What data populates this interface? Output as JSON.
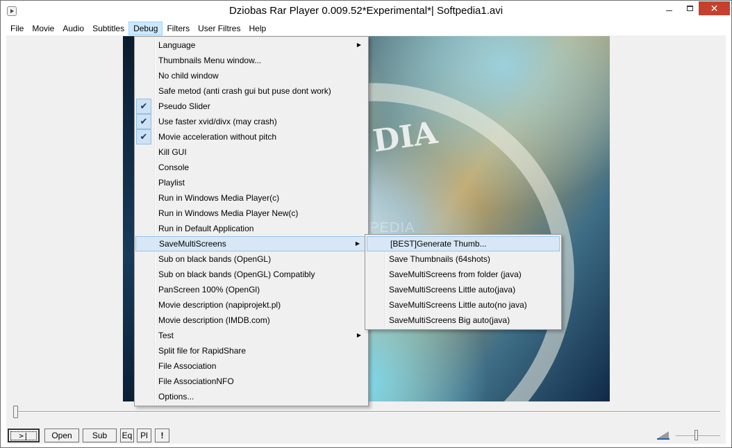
{
  "window": {
    "title": "Dziobas Rar Player 0.009.52*Experimental*| Softpedia1.avi",
    "minimize_label": "",
    "maximize_label": "",
    "close_label": "✕"
  },
  "menubar": {
    "items": [
      "File",
      "Movie",
      "Audio",
      "Subtitles",
      "Debug",
      "Filters",
      "User Filtres",
      "Help"
    ],
    "active": "Debug"
  },
  "debug_menu": {
    "items": [
      {
        "label": "Language",
        "submenu": true
      },
      {
        "label": "Thumbnails Menu window..."
      },
      {
        "label": "No child window"
      },
      {
        "label": "Safe metod (anti crash gui but puse dont work)"
      },
      {
        "label": "Pseudo Slider",
        "checked": true
      },
      {
        "label": "Use faster xvid/divx (may crash)",
        "checked": true
      },
      {
        "label": "Movie acceleration without pitch",
        "checked": true
      },
      {
        "label": "Kill GUI"
      },
      {
        "label": "Console"
      },
      {
        "label": "Playlist"
      },
      {
        "label": "Run in Windows Media Player(c)"
      },
      {
        "label": "Run in Windows Media Player New(c)"
      },
      {
        "label": "Run in Default Application"
      },
      {
        "label": "SaveMultiScreens",
        "submenu": true,
        "highlighted": true
      },
      {
        "label": "Sub on black bands (OpenGL)"
      },
      {
        "label": "Sub on black bands (OpenGL) Compatibly"
      },
      {
        "label": "PanScreen 100% (OpenGl)"
      },
      {
        "label": "Movie description (napiprojekt.pl)"
      },
      {
        "label": "Movie description (IMDB.com)"
      },
      {
        "label": "Test",
        "submenu": true
      },
      {
        "label": "Split file for RapidShare"
      },
      {
        "label": "File Association"
      },
      {
        "label": "File AssociationNFO"
      },
      {
        "label": "Options..."
      }
    ],
    "check_glyph": "✔",
    "arrow_glyph": "▶"
  },
  "savemultiscreens_submenu": {
    "items": [
      {
        "label": "[BEST]Generate Thumb...",
        "highlighted": true
      },
      {
        "label": "Save Thumbnails (64shots)"
      },
      {
        "label": "SaveMultiScreens from folder (java)"
      },
      {
        "label": "SaveMultiScreens Little auto(java)"
      },
      {
        "label": "SaveMultiScreens Little auto(no java)"
      },
      {
        "label": "SaveMultiScreens Big auto(java)"
      }
    ]
  },
  "video": {
    "watermark": "SOFTPEDIA",
    "overlay_text": "DIA"
  },
  "controls": {
    "play_label": ">|",
    "open_label": "Open",
    "sub_label": "Sub",
    "eq_label": "Eq",
    "pl_label": "Pl",
    "excl_label": "!",
    "seek_position": 0.0,
    "volume_level": 0.42
  },
  "colors": {
    "menu_active_bg": "#cce8ff",
    "highlight_bg": "#d8e7f5",
    "close_button": "#c7402e",
    "check_bg": "#cde2f4"
  }
}
